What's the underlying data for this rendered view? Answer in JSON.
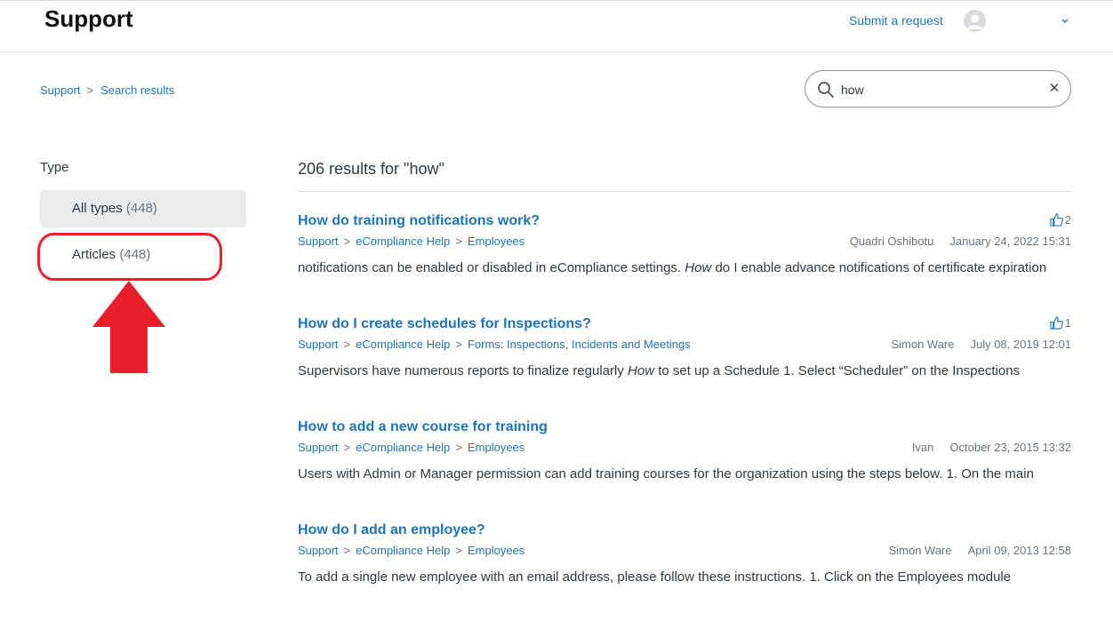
{
  "header": {
    "brand": "Support",
    "submit_request": "Submit a request",
    "avatar_icon": "user-avatar-icon",
    "menu_icon": "chevron-down-icon"
  },
  "breadcrumb": {
    "items": [
      "Support",
      "Search results"
    ],
    "separator": ">"
  },
  "search": {
    "value": "how",
    "search_icon": "search-icon",
    "clear_icon": "close-icon",
    "clear_glyph": "✕"
  },
  "filters": {
    "title": "Type",
    "items": [
      {
        "label": "All types",
        "count": "(448)",
        "selected": true
      },
      {
        "label": "Articles",
        "count": "(448)",
        "selected": false
      }
    ]
  },
  "annotation": {
    "color": "#e8202a",
    "shapes": [
      "highlight-ellipse",
      "up-arrow"
    ]
  },
  "results": {
    "heading": "206 results for \"how\"",
    "items": [
      {
        "title": "How do training notifications work?",
        "crumbs": [
          "Support",
          "eCompliance Help",
          "Employees"
        ],
        "author": "Quadri Oshibotu",
        "date": "January 24, 2022 15:31",
        "votes": "2",
        "snippet_pre": "notifications can be enabled or disabled in eCompliance settings. ",
        "snippet_em": "How",
        "snippet_post": " do I enable advance notifications of certificate expiration"
      },
      {
        "title": "How do I create schedules for Inspections?",
        "crumbs": [
          "Support",
          "eCompliance Help",
          "Forms: Inspections, Incidents and Meetings"
        ],
        "author": "Simon Ware",
        "date": "July 08, 2019 12:01",
        "votes": "1",
        "snippet_pre": "Supervisors have numerous reports to finalize regularly ",
        "snippet_em": "How",
        "snippet_post": " to set up a Schedule 1. Select “Scheduler” on the Inspections"
      },
      {
        "title": "How to add a new course for training",
        "crumbs": [
          "Support",
          "eCompliance Help",
          "Employees"
        ],
        "author": "Ivan",
        "date": "October 23, 2015 13:32",
        "votes": "",
        "snippet_pre": "Users with Admin or Manager permission can add training courses for the organization using the steps below. 1. On the main",
        "snippet_em": "",
        "snippet_post": ""
      },
      {
        "title": "How do I add an employee?",
        "crumbs": [
          "Support",
          "eCompliance Help",
          "Employees"
        ],
        "author": "Simon Ware",
        "date": "April 09, 2013 12:58",
        "votes": "",
        "snippet_pre": "To add a single new employee with an email address, please follow these instructions. 1. Click on the Employees module",
        "snippet_em": "",
        "snippet_post": ""
      }
    ]
  },
  "colors": {
    "link": "#1f73b7",
    "text": "#2f3941",
    "muted": "#68737d",
    "selected_bg": "#e9ebed"
  }
}
